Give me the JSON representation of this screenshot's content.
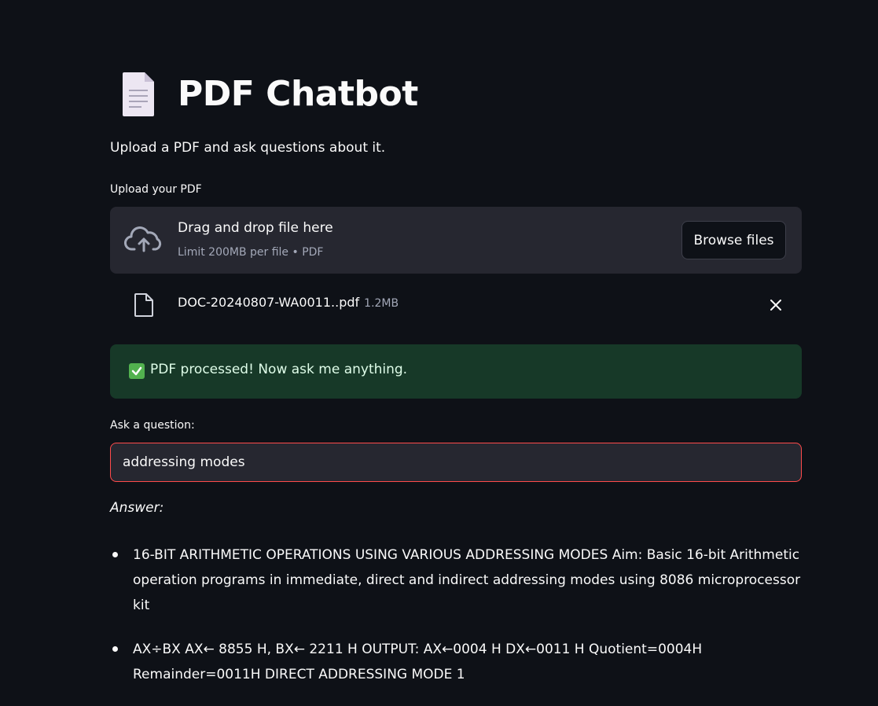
{
  "header": {
    "icon": "page-facing-up-emoji",
    "title": "PDF Chatbot",
    "subtitle": "Upload a PDF and ask questions about it."
  },
  "uploader": {
    "label": "Upload your PDF",
    "drop_title": "Drag and drop file here",
    "limit_text": "Limit 200MB per file • PDF",
    "browse_label": "Browse files",
    "icon": "cloud-upload-icon",
    "file": {
      "name": "DOC-20240807-WA0011..pdf",
      "size": "1.2MB",
      "icon": "file-icon"
    }
  },
  "status": {
    "icon": "check-box-emoji",
    "text": "PDF processed! Now ask me anything."
  },
  "question": {
    "label": "Ask a question:",
    "value": "addressing modes"
  },
  "answer": {
    "label": "Answer:",
    "items": [
      "16-BIT ARITHMETIC OPERATIONS USING VARIOUS ADDRESSING MODES Aim: Basic 16-bit Arithmetic operation programs in immediate, direct and indirect addressing modes using 8086 microprocessor kit",
      "AX÷BX AX← 8855 H, BX← 2211 H OUTPUT: AX←0004 H DX←0011 H Quotient=0004H Remainder=0011H  DIRECT ADDRESSING MODE 1"
    ]
  },
  "colors": {
    "background": "#0e1117",
    "panel": "#262730",
    "success_bg": "#173928",
    "accent_border": "#ff4b4b"
  }
}
